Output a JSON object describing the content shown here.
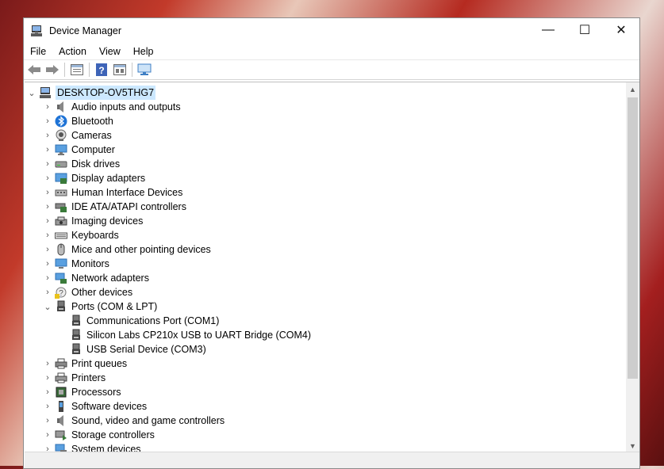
{
  "window": {
    "title": "Device Manager",
    "buttons": {
      "minimize": "—",
      "maximize": "☐",
      "close": "✕"
    }
  },
  "menu": [
    "File",
    "Action",
    "View",
    "Help"
  ],
  "toolbar_icons": [
    "back-arrow-icon",
    "forward-arrow-icon",
    "properties-icon",
    "help-icon",
    "view-icon",
    "scan-hardware-icon"
  ],
  "tree": {
    "root": "DESKTOP-OV5THG7",
    "categories": [
      {
        "label": "Audio inputs and outputs",
        "icon": "speaker-icon",
        "expanded": false
      },
      {
        "label": "Bluetooth",
        "icon": "bluetooth-icon",
        "expanded": false
      },
      {
        "label": "Cameras",
        "icon": "camera-icon",
        "expanded": false
      },
      {
        "label": "Computer",
        "icon": "computer-icon",
        "expanded": false
      },
      {
        "label": "Disk drives",
        "icon": "disk-drive-icon",
        "expanded": false
      },
      {
        "label": "Display adapters",
        "icon": "display-adapter-icon",
        "expanded": false
      },
      {
        "label": "Human Interface Devices",
        "icon": "hid-icon",
        "expanded": false
      },
      {
        "label": "IDE ATA/ATAPI controllers",
        "icon": "ide-controller-icon",
        "expanded": false
      },
      {
        "label": "Imaging devices",
        "icon": "imaging-icon",
        "expanded": false
      },
      {
        "label": "Keyboards",
        "icon": "keyboard-icon",
        "expanded": false
      },
      {
        "label": "Mice and other pointing devices",
        "icon": "mouse-icon",
        "expanded": false
      },
      {
        "label": "Monitors",
        "icon": "monitor-icon",
        "expanded": false
      },
      {
        "label": "Network adapters",
        "icon": "network-icon",
        "expanded": false
      },
      {
        "label": "Other devices",
        "icon": "unknown-device-icon",
        "expanded": false
      },
      {
        "label": "Ports (COM & LPT)",
        "icon": "port-icon",
        "expanded": true,
        "children": [
          "Communications Port (COM1)",
          "Silicon Labs CP210x USB to UART Bridge (COM4)",
          "USB Serial Device (COM3)"
        ]
      },
      {
        "label": "Print queues",
        "icon": "print-queue-icon",
        "expanded": false
      },
      {
        "label": "Printers",
        "icon": "printer-icon",
        "expanded": false
      },
      {
        "label": "Processors",
        "icon": "processor-icon",
        "expanded": false
      },
      {
        "label": "Software devices",
        "icon": "software-device-icon",
        "expanded": false
      },
      {
        "label": "Sound, video and game controllers",
        "icon": "sound-icon",
        "expanded": false
      },
      {
        "label": "Storage controllers",
        "icon": "storage-controller-icon",
        "expanded": false
      },
      {
        "label": "System devices",
        "icon": "system-device-icon",
        "expanded": false
      }
    ]
  },
  "colors": {
    "selection": "#cce8ff",
    "accent": "#0078d7"
  }
}
